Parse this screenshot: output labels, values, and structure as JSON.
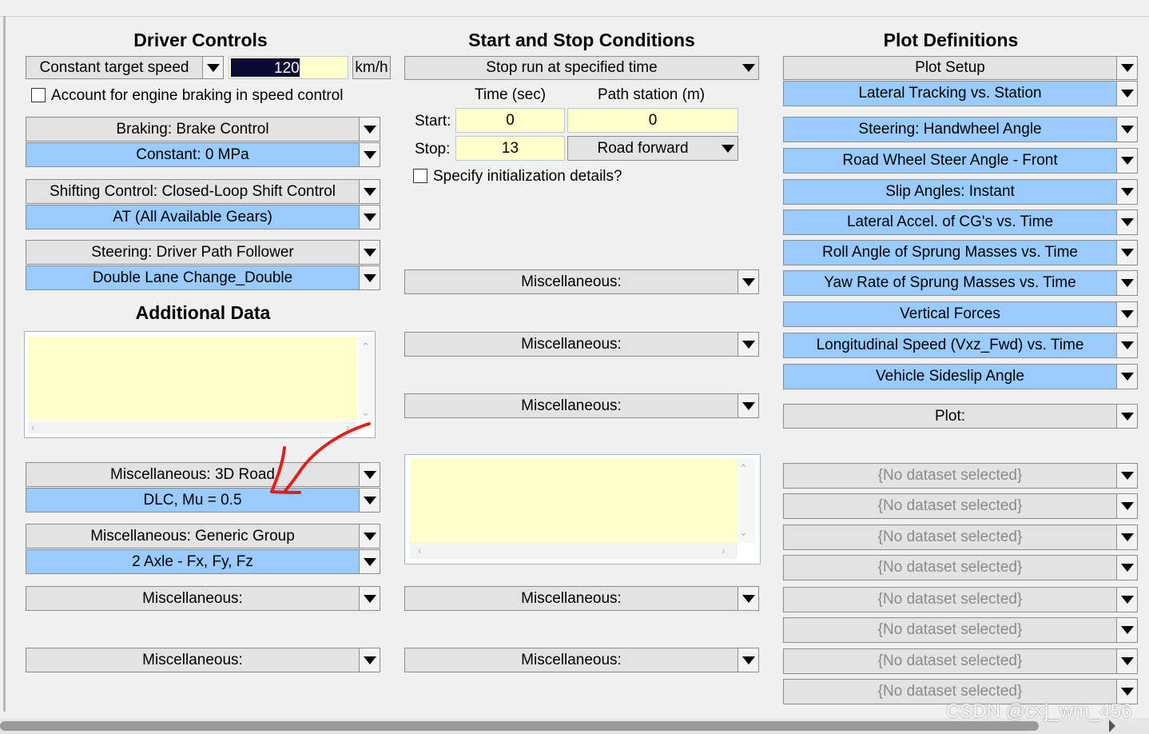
{
  "driver_controls": {
    "title": "Driver Controls",
    "speed_mode": "Constant target speed",
    "speed_value": "120",
    "speed_unit": "km/h",
    "engine_braking_label": "Account for engine braking in speed control",
    "braking": "Braking: Brake Control",
    "braking_dataset": "Constant: 0 MPa",
    "shifting": "Shifting Control: Closed-Loop Shift Control",
    "shifting_dataset": "AT (All Available Gears)",
    "steering": "Steering: Driver Path Follower",
    "steering_dataset": "Double Lane Change_Double",
    "additional_data_title": "Additional Data",
    "misc_road": "Miscellaneous: 3D Road",
    "misc_road_dataset": "DLC, Mu = 0.5",
    "misc_group": "Miscellaneous: Generic Group",
    "misc_group_dataset": "2 Axle - Fx, Fy, Fz",
    "misc_1": "Miscellaneous:",
    "misc_2": "Miscellaneous:"
  },
  "start_stop": {
    "title": "Start and Stop Conditions",
    "stop_mode": "Stop run at specified time",
    "col_time": "Time (sec)",
    "col_station": "Path station (m)",
    "start_label": "Start:",
    "start_time": "0",
    "start_station": "0",
    "stop_label": "Stop:",
    "stop_time": "13",
    "stop_station_mode": "Road forward",
    "init_details_label": "Specify initialization details?",
    "misc_1": "Miscellaneous:",
    "misc_2": "Miscellaneous:",
    "misc_3": "Miscellaneous:",
    "misc_4": "Miscellaneous:",
    "misc_5": "Miscellaneous:"
  },
  "plot_definitions": {
    "title": "Plot Definitions",
    "plot_setup": "Plot Setup",
    "items": [
      "Lateral Tracking vs. Station",
      "Steering: Handwheel Angle",
      "Road Wheel Steer Angle - Front",
      "Slip Angles: Instant",
      "Lateral Accel. of CG's vs. Time",
      "Roll Angle of Sprung Masses vs. Time",
      "Yaw Rate of Sprung Masses vs. Time",
      "Vertical Forces",
      "Longitudinal Speed (Vxz_Fwd) vs. Time",
      "Vehicle Sideslip Angle"
    ],
    "plot_label": "Plot:",
    "empty_slots": [
      "{No dataset selected}",
      "{No dataset selected}",
      "{No dataset selected}",
      "{No dataset selected}",
      "{No dataset selected}",
      "{No dataset selected}",
      "{No dataset selected}",
      "{No dataset selected}"
    ]
  },
  "watermark": "CSDN @cxj_wm_456",
  "colors": {
    "window_bg": "#f0f0f0",
    "dataset_blue": "#99cbff",
    "field_yellow": "#ffffcc",
    "speed_field_dark": "#0a0a33",
    "annotation_arrow": "#e0201c"
  }
}
